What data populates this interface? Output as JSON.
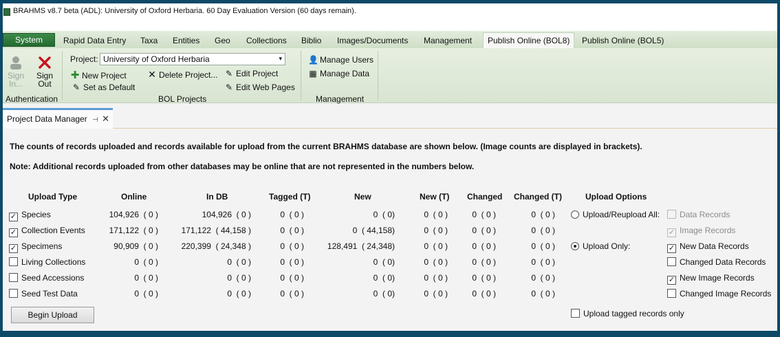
{
  "window_title": "BRAHMS v8.7 beta (ADL): University of Oxford Herbaria. 60 Day Evaluation Version (60 days remain).",
  "tabs": [
    "System",
    "Rapid Data Entry",
    "Taxa",
    "Entities",
    "Geo",
    "Collections",
    "Biblio",
    "Images/Documents",
    "Management",
    "Publish Online (BOL8)",
    "Publish Online (BOL5)"
  ],
  "active_tab": "Publish Online (BOL8)",
  "ribbon": {
    "auth": {
      "sign_in": "Sign In...",
      "sign_out": "Sign Out",
      "group": "Authentication"
    },
    "bol": {
      "project_label": "Project:",
      "project_value": "University of Oxford Herbaria",
      "new_project": "New Project",
      "delete_project": "Delete Project...",
      "edit_project": "Edit Project",
      "set_default": "Set as Default",
      "edit_web_pages": "Edit Web Pages",
      "group": "BOL Projects"
    },
    "mgmt": {
      "manage_users": "Manage Users",
      "manage_data": "Manage Data",
      "group": "Management"
    }
  },
  "doc_tab": {
    "label": "Project Data Manager"
  },
  "notes": {
    "line1": "The counts of records uploaded and records available for upload from the current BRAHMS database are shown below.  (Image counts are displayed in brackets).",
    "line2": "Note:  Additional records uploaded from other databases may be online that are not represented in the numbers below."
  },
  "table": {
    "headers": [
      "Upload Type",
      "Online",
      "In DB",
      "Tagged (T)",
      "New",
      "New (T)",
      "Changed",
      "Changed (T)"
    ],
    "rows": [
      {
        "label": "Species",
        "checked": true,
        "online": "104,926  ( 0 )",
        "indb": "104,926  ( 0 )",
        "tagged": "0  ( 0 )",
        "new": "0  ( 0)",
        "new_t": "0  ( 0 )",
        "changed": "0  ( 0 )",
        "changed_t": "0  ( 0 )"
      },
      {
        "label": "Collection Events",
        "checked": true,
        "online": "171,122  ( 0 )",
        "indb": "171,122  ( 44,158 )",
        "tagged": "0  ( 0 )",
        "new": "0  ( 44,158)",
        "new_t": "0  ( 0 )",
        "changed": "0  ( 0 )",
        "changed_t": "0  ( 0 )"
      },
      {
        "label": "Specimens",
        "checked": true,
        "online": "90,909  ( 0 )",
        "indb": "220,399  ( 24,348 )",
        "tagged": "0  ( 0 )",
        "new": "128,491  ( 24,348)",
        "new_t": "0  ( 0 )",
        "changed": "0  ( 0 )",
        "changed_t": "0  ( 0 )"
      },
      {
        "label": "Living Collections",
        "checked": false,
        "online": "0  ( 0 )",
        "indb": "0  ( 0 )",
        "tagged": "0  ( 0 )",
        "new": "0  ( 0)",
        "new_t": "0  ( 0 )",
        "changed": "0  ( 0 )",
        "changed_t": "0  ( 0 )"
      },
      {
        "label": "Seed Accessions",
        "checked": false,
        "online": "0  ( 0 )",
        "indb": "0  ( 0 )",
        "tagged": "0  ( 0 )",
        "new": "0  ( 0)",
        "new_t": "0  ( 0 )",
        "changed": "0  ( 0 )",
        "changed_t": "0  ( 0 )"
      },
      {
        "label": "Seed Test Data",
        "checked": false,
        "online": "0  ( 0 )",
        "indb": "0  ( 0 )",
        "tagged": "0  ( 0 )",
        "new": "0  ( 0)",
        "new_t": "0  ( 0 )",
        "changed": "0  ( 0 )",
        "changed_t": "0  ( 0 )"
      }
    ]
  },
  "upload_options": {
    "title": "Upload Options",
    "upload_all": {
      "label": "Upload/Reupload All:",
      "selected": false
    },
    "upload_only": {
      "label": "Upload Only:",
      "selected": true
    },
    "checks": [
      {
        "label": "Data Records",
        "checked": false,
        "disabled": true
      },
      {
        "label": "Image Records",
        "checked": true,
        "disabled": true
      },
      {
        "label": "New Data Records",
        "checked": true,
        "disabled": false
      },
      {
        "label": "Changed Data Records",
        "checked": false,
        "disabled": false
      },
      {
        "label": "New Image Records",
        "checked": true,
        "disabled": false
      },
      {
        "label": "Changed Image Records",
        "checked": false,
        "disabled": false
      }
    ],
    "tagged_only": {
      "label": "Upload tagged records only",
      "checked": false
    }
  },
  "begin_upload": "Begin Upload"
}
